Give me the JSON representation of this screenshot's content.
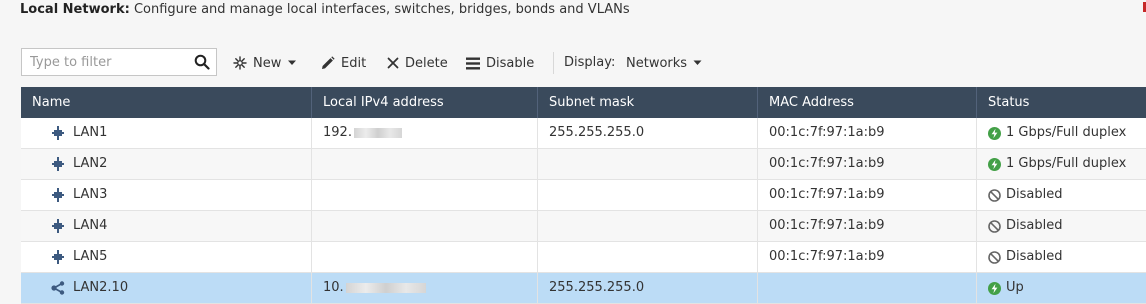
{
  "header": {
    "title": "Local Network:",
    "description": "Configure and manage local interfaces, switches, bridges, bonds and VLANs"
  },
  "toolbar": {
    "filter_placeholder": "Type to filter",
    "new_label": "New",
    "edit_label": "Edit",
    "delete_label": "Delete",
    "disable_label": "Disable",
    "display_label": "Display:",
    "display_value": "Networks"
  },
  "table": {
    "columns": [
      "Name",
      "Local IPv4 address",
      "Subnet mask",
      "MAC Address",
      "Status"
    ],
    "rows": [
      {
        "name": "LAN1",
        "icon": "network-port-icon",
        "ip": "192.",
        "ip_blurred": true,
        "mask": "255.255.255.0",
        "mac": "00:1c:7f:97:1a:b9",
        "status": "1 Gbps/Full duplex",
        "status_icon": "lightning-icon",
        "selected": false
      },
      {
        "name": "LAN2",
        "icon": "network-port-icon",
        "ip": "",
        "ip_blurred": false,
        "mask": "",
        "mac": "00:1c:7f:97:1a:b9",
        "status": "1 Gbps/Full duplex",
        "status_icon": "lightning-icon",
        "selected": false
      },
      {
        "name": "LAN3",
        "icon": "network-port-icon",
        "ip": "",
        "ip_blurred": false,
        "mask": "",
        "mac": "00:1c:7f:97:1a:b9",
        "status": "Disabled",
        "status_icon": "disabled-icon",
        "selected": false
      },
      {
        "name": "LAN4",
        "icon": "network-port-icon",
        "ip": "",
        "ip_blurred": false,
        "mask": "",
        "mac": "00:1c:7f:97:1a:b9",
        "status": "Disabled",
        "status_icon": "disabled-icon",
        "selected": false
      },
      {
        "name": "LAN5",
        "icon": "network-port-icon",
        "ip": "",
        "ip_blurred": false,
        "mask": "",
        "mac": "00:1c:7f:97:1a:b9",
        "status": "Disabled",
        "status_icon": "disabled-icon",
        "selected": false
      },
      {
        "name": "LAN2.10",
        "icon": "vlan-icon",
        "ip": "10.",
        "ip_blurred": true,
        "mask": "255.255.255.0",
        "mac": "",
        "status": "Up",
        "status_icon": "lightning-icon",
        "selected": true
      }
    ]
  },
  "colors": {
    "header_bg": "#3a4a5c",
    "selected_row": "#bcdcf6",
    "icon_blue": "#3d5a80",
    "status_green": "#43a047",
    "status_gray": "#666666"
  }
}
